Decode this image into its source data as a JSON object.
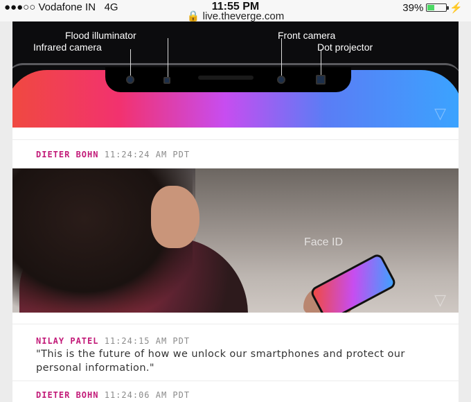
{
  "status_bar": {
    "carrier": "●●●○○ Vodafone IN",
    "network": "4G",
    "time": "11:55 PM",
    "url": "live.theverge.com",
    "battery_percent": "39%",
    "battery_level": 0.39
  },
  "hero_image_1": {
    "labels": {
      "flood_illuminator": "Flood illuminator",
      "infrared_camera": "Infrared camera",
      "front_camera": "Front camera",
      "dot_projector": "Dot projector"
    }
  },
  "posts": [
    {
      "author": "DIETER BOHN",
      "time": "11:24:24 AM PDT"
    },
    {
      "author": "NILAY PATEL",
      "time": "11:24:15 AM PDT",
      "text": "\"This is the future of how we unlock our smartphones and protect our personal information.\""
    },
    {
      "author": "DIETER BOHN",
      "time": "11:24:06 AM PDT"
    }
  ],
  "hero_image_2": {
    "caption": "Face ID"
  },
  "colors": {
    "author": "#c21a78",
    "timestamp": "#8a8a8a"
  }
}
